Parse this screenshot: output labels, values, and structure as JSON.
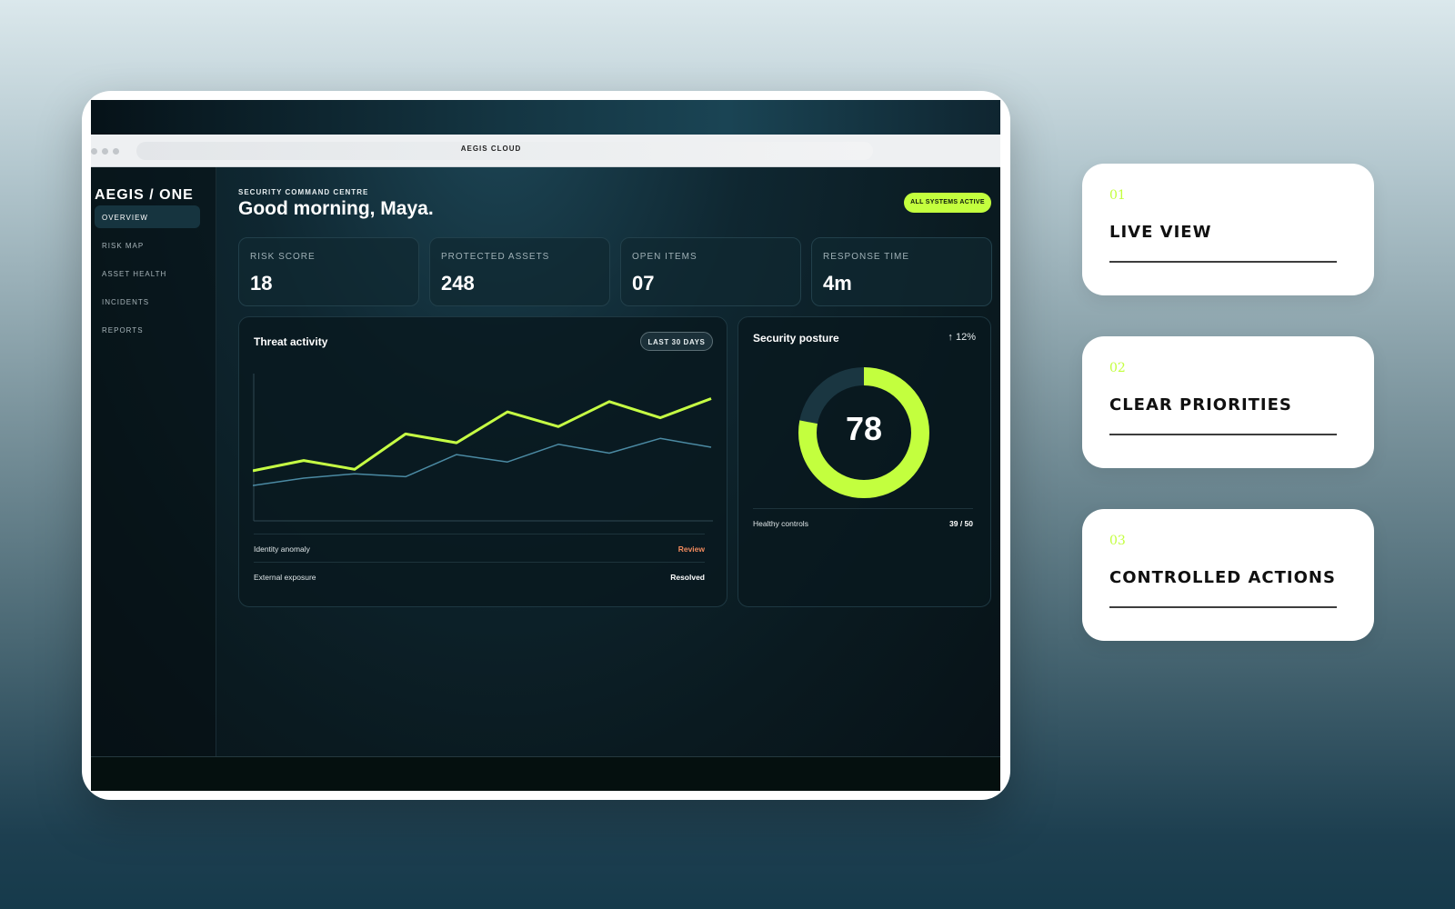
{
  "browser": {
    "title": "AEGIS CLOUD"
  },
  "sidebar": {
    "brand": "AEGIS / ONE",
    "items": [
      {
        "label": "OVERVIEW",
        "active": true
      },
      {
        "label": "RISK MAP",
        "active": false
      },
      {
        "label": "ASSET HEALTH",
        "active": false
      },
      {
        "label": "INCIDENTS",
        "active": false
      },
      {
        "label": "REPORTS",
        "active": false
      }
    ]
  },
  "header": {
    "eyebrow": "SECURITY COMMAND CENTRE",
    "greeting": "Good morning, Maya.",
    "status": "ALL SYSTEMS ACTIVE"
  },
  "kpis": [
    {
      "label": "RISK SCORE",
      "value": "18"
    },
    {
      "label": "PROTECTED ASSETS",
      "value": "248"
    },
    {
      "label": "OPEN ITEMS",
      "value": "07"
    },
    {
      "label": "RESPONSE TIME",
      "value": "4m"
    }
  ],
  "threat": {
    "title": "Threat activity",
    "range": "LAST 30 DAYS",
    "rows": [
      {
        "name": "Identity anomaly",
        "status": "Review",
        "status_color": "#f08a5d"
      },
      {
        "name": "External exposure",
        "status": "Resolved",
        "status_color": "#ffffff"
      }
    ]
  },
  "posture": {
    "title": "Security posture",
    "delta": "↑ 12%",
    "score": "78",
    "score_fraction": 0.78,
    "row_label": "Healthy controls",
    "row_value": "39 / 50"
  },
  "chart_data": {
    "type": "line",
    "x": [
      1,
      2,
      3,
      4,
      5,
      6,
      7,
      8,
      9,
      10
    ],
    "ylim": [
      0,
      100
    ],
    "series": [
      {
        "values": [
          34,
          41,
          35,
          59,
          53,
          74,
          64,
          81,
          70,
          83
        ],
        "color": "#c6ff44"
      },
      {
        "values": [
          24,
          29,
          32,
          30,
          45,
          40,
          52,
          46,
          56,
          50
        ],
        "color": "#4b8aa3"
      }
    ]
  },
  "features": [
    {
      "num": "01",
      "title": "LIVE VIEW"
    },
    {
      "num": "02",
      "title": "CLEAR PRIORITIES"
    },
    {
      "num": "03",
      "title": "CONTROLLED ACTIONS"
    }
  ]
}
